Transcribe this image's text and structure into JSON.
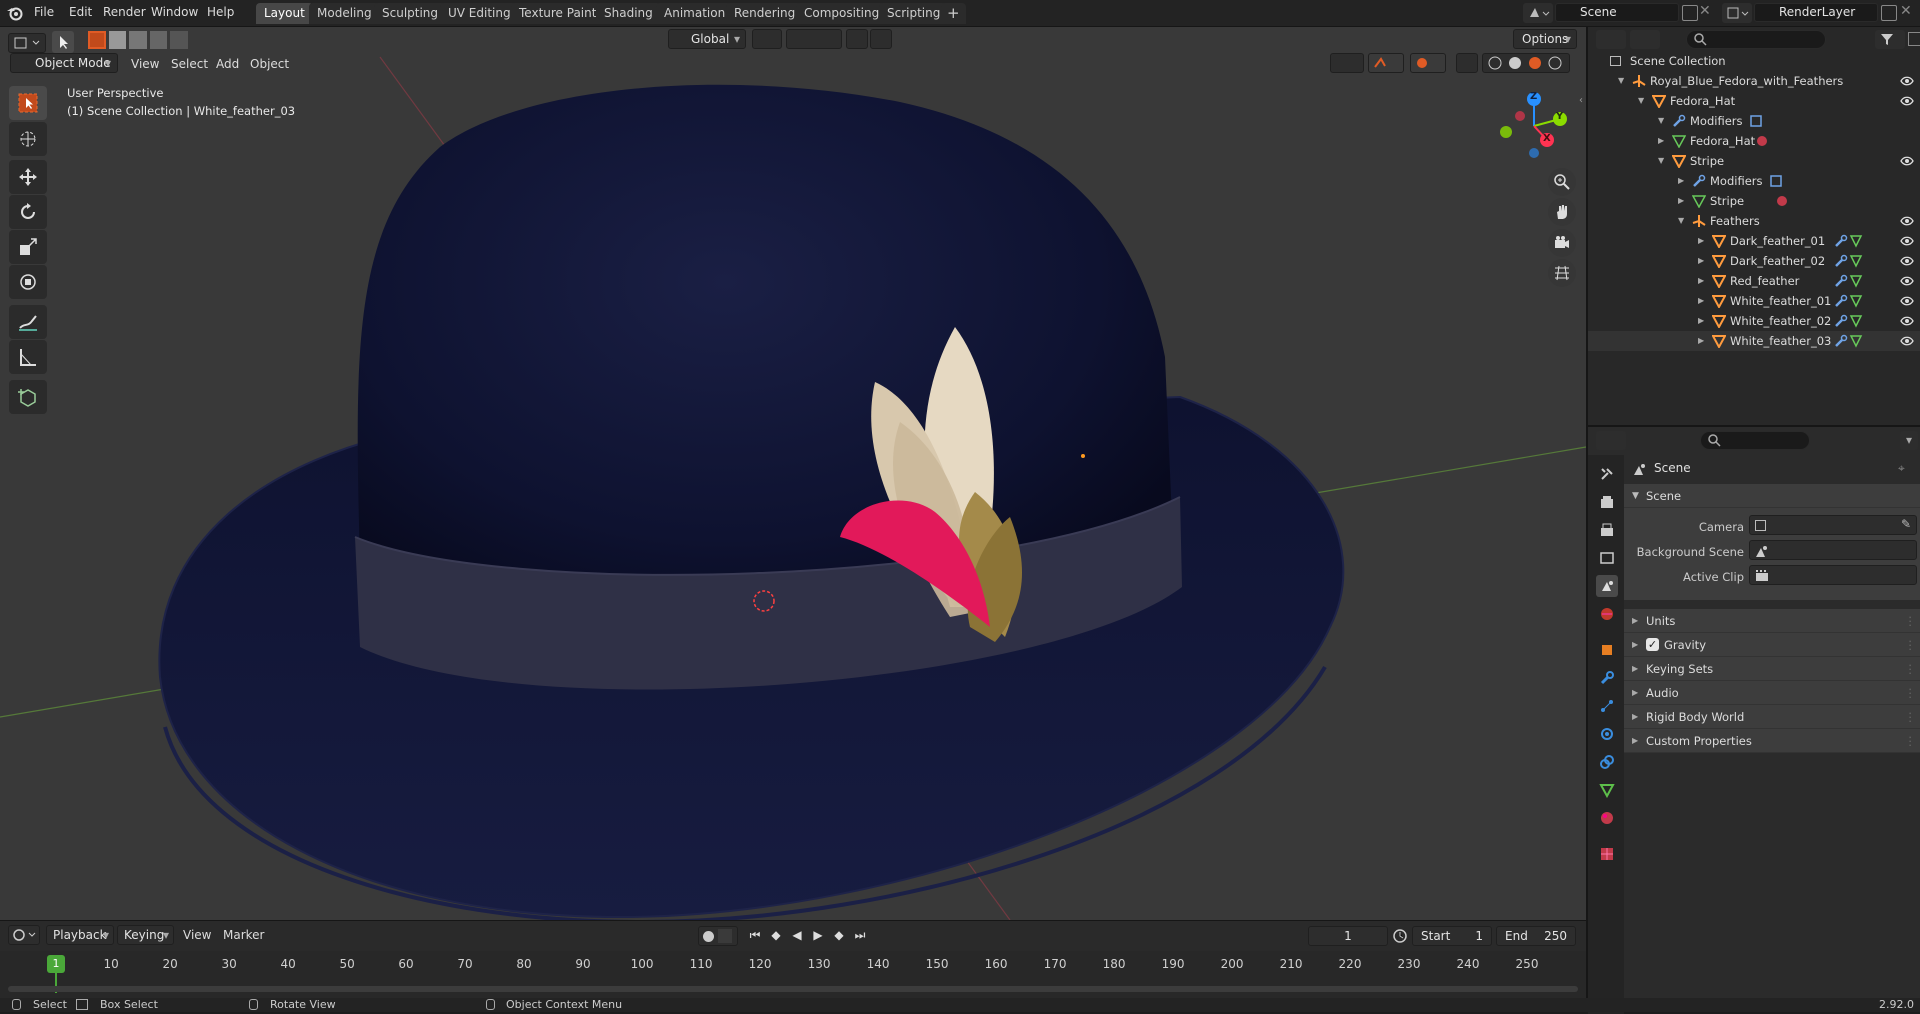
{
  "topbar": {
    "menu": [
      "File",
      "Edit",
      "Render",
      "Window",
      "Help"
    ],
    "workspaces": [
      "Layout",
      "Modeling",
      "Sculpting",
      "UV Editing",
      "Texture Paint",
      "Shading",
      "Animation",
      "Rendering",
      "Compositing",
      "Scripting"
    ],
    "active_workspace": "Layout",
    "scene": "Scene",
    "view_layer": "RenderLayer"
  },
  "viewport": {
    "mode": "Object Mode",
    "menu": [
      "View",
      "Select",
      "Add",
      "Object"
    ],
    "orientation": "Global",
    "options_label": "Options",
    "overlay_line1": "User Perspective",
    "overlay_line2": "(1) Scene Collection | White_feather_03",
    "gizmo_axes": [
      "Z",
      "Y",
      "X"
    ]
  },
  "outliner": {
    "root": "Scene Collection",
    "rows": [
      {
        "label": "Royal_Blue_Fedora_with_Feathers",
        "icon": "empty-icon",
        "depth": 1
      },
      {
        "label": "Fedora_Hat",
        "icon": "mesh-icon",
        "depth": 2
      },
      {
        "label": "Modifiers",
        "icon": "wrench-icon",
        "depth": 3
      },
      {
        "label": "Fedora_Hat",
        "icon": "mesh-data-icon",
        "depth": 3
      },
      {
        "label": "Stripe",
        "icon": "mesh-icon",
        "depth": 3
      },
      {
        "label": "Modifiers",
        "icon": "wrench-icon",
        "depth": 4
      },
      {
        "label": "Stripe",
        "icon": "mesh-data-icon",
        "depth": 4
      },
      {
        "label": "Feathers",
        "icon": "empty-icon",
        "depth": 4
      },
      {
        "label": "Dark_feather_01",
        "icon": "mesh-icon",
        "depth": 5
      },
      {
        "label": "Dark_feather_02",
        "icon": "mesh-icon",
        "depth": 5
      },
      {
        "label": "Red_feather",
        "icon": "mesh-icon",
        "depth": 5
      },
      {
        "label": "White_feather_01",
        "icon": "mesh-icon",
        "depth": 5
      },
      {
        "label": "White_feather_02",
        "icon": "mesh-icon",
        "depth": 5
      },
      {
        "label": "White_feather_03",
        "icon": "mesh-icon",
        "depth": 5
      }
    ]
  },
  "properties": {
    "header": "Scene",
    "scene_section": "Scene",
    "fields": [
      {
        "label": "Camera"
      },
      {
        "label": "Background Scene"
      },
      {
        "label": "Active Clip"
      }
    ],
    "sections": [
      "Units",
      "Gravity",
      "Keying Sets",
      "Audio",
      "Rigid Body World",
      "Custom Properties"
    ],
    "gravity_checked": true
  },
  "timeline": {
    "menu": [
      "Playback",
      "Keying",
      "View",
      "Marker"
    ],
    "current_frame": "1",
    "start_label": "Start",
    "start": "1",
    "end_label": "End",
    "end": "250",
    "ticks": [
      "10",
      "20",
      "30",
      "40",
      "50",
      "60",
      "70",
      "80",
      "90",
      "100",
      "110",
      "120",
      "130",
      "140",
      "150",
      "160",
      "170",
      "180",
      "190",
      "200",
      "210",
      "220",
      "230",
      "240",
      "250"
    ],
    "playhead": "1"
  },
  "status": {
    "select": "Select",
    "box_select": "Box Select",
    "rotate_view": "Rotate View",
    "context_menu": "Object Context Menu",
    "version": "2.92.0"
  },
  "colors": {
    "accent": "#4772b3",
    "active_tab": "#474747",
    "hat": "#101433",
    "x_axis": "#ff3352",
    "y_axis": "#8bdc00",
    "z_axis": "#2890ff",
    "playhead": "#4aa839"
  }
}
